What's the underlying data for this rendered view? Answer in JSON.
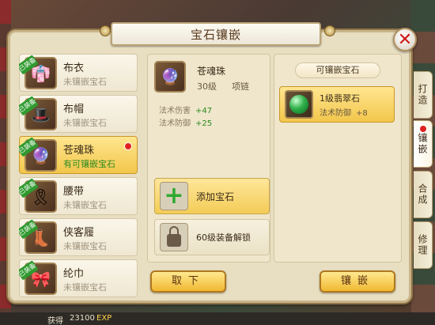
{
  "window": {
    "title": "宝石镶嵌",
    "close_symbol": "✕"
  },
  "equipment_list": [
    {
      "name": "布衣",
      "status": "未镶嵌宝石",
      "badge": "已装备",
      "icon": "cloth-armor-icon",
      "selected": false
    },
    {
      "name": "布帽",
      "status": "未镶嵌宝石",
      "badge": "已装备",
      "icon": "cloth-hat-icon",
      "selected": false
    },
    {
      "name": "苍魂珠",
      "status": "有可镶嵌宝石",
      "badge": "已装备",
      "icon": "soul-orb-icon",
      "selected": true,
      "has_alert": true
    },
    {
      "name": "腰带",
      "status": "未镶嵌宝石",
      "badge": "已装备",
      "icon": "belt-icon",
      "selected": false
    },
    {
      "name": "侠客履",
      "status": "未镶嵌宝石",
      "badge": "已装备",
      "icon": "boots-icon",
      "selected": false
    },
    {
      "name": "纶巾",
      "status": "未镶嵌宝石",
      "badge": "已装备",
      "icon": "headband-icon",
      "selected": false
    }
  ],
  "selected_item": {
    "name": "苍魂珠",
    "level": "30级",
    "type": "项链",
    "attributes": [
      {
        "label": "法术伤害",
        "value": "+47"
      },
      {
        "label": "法术防御",
        "value": "+25"
      }
    ]
  },
  "slots": {
    "add_label": "添加宝石",
    "lock_label": "60级装备解锁"
  },
  "gems_panel": {
    "title": "可镶嵌宝石",
    "gems": [
      {
        "name": "1级翡翠石",
        "attr_label": "法术防御",
        "attr_value": "+8",
        "icon": "emerald-gem-icon"
      }
    ]
  },
  "side_tabs": [
    {
      "label": "打造",
      "active": false
    },
    {
      "label": "镶嵌",
      "active": true,
      "has_alert": true
    },
    {
      "label": "合成",
      "active": false
    },
    {
      "label": "修理",
      "active": false
    }
  ],
  "buttons": {
    "remove_label": "取下",
    "inlay_label": "镶嵌"
  },
  "background_text": {
    "gain_label": "获得",
    "gain_value": "23100",
    "exp_tag": "EXP"
  },
  "colors": {
    "highlight": "#f2c64b",
    "panel": "#e8dfc2",
    "green": "#2e8a1e",
    "alert": "#e02020"
  }
}
